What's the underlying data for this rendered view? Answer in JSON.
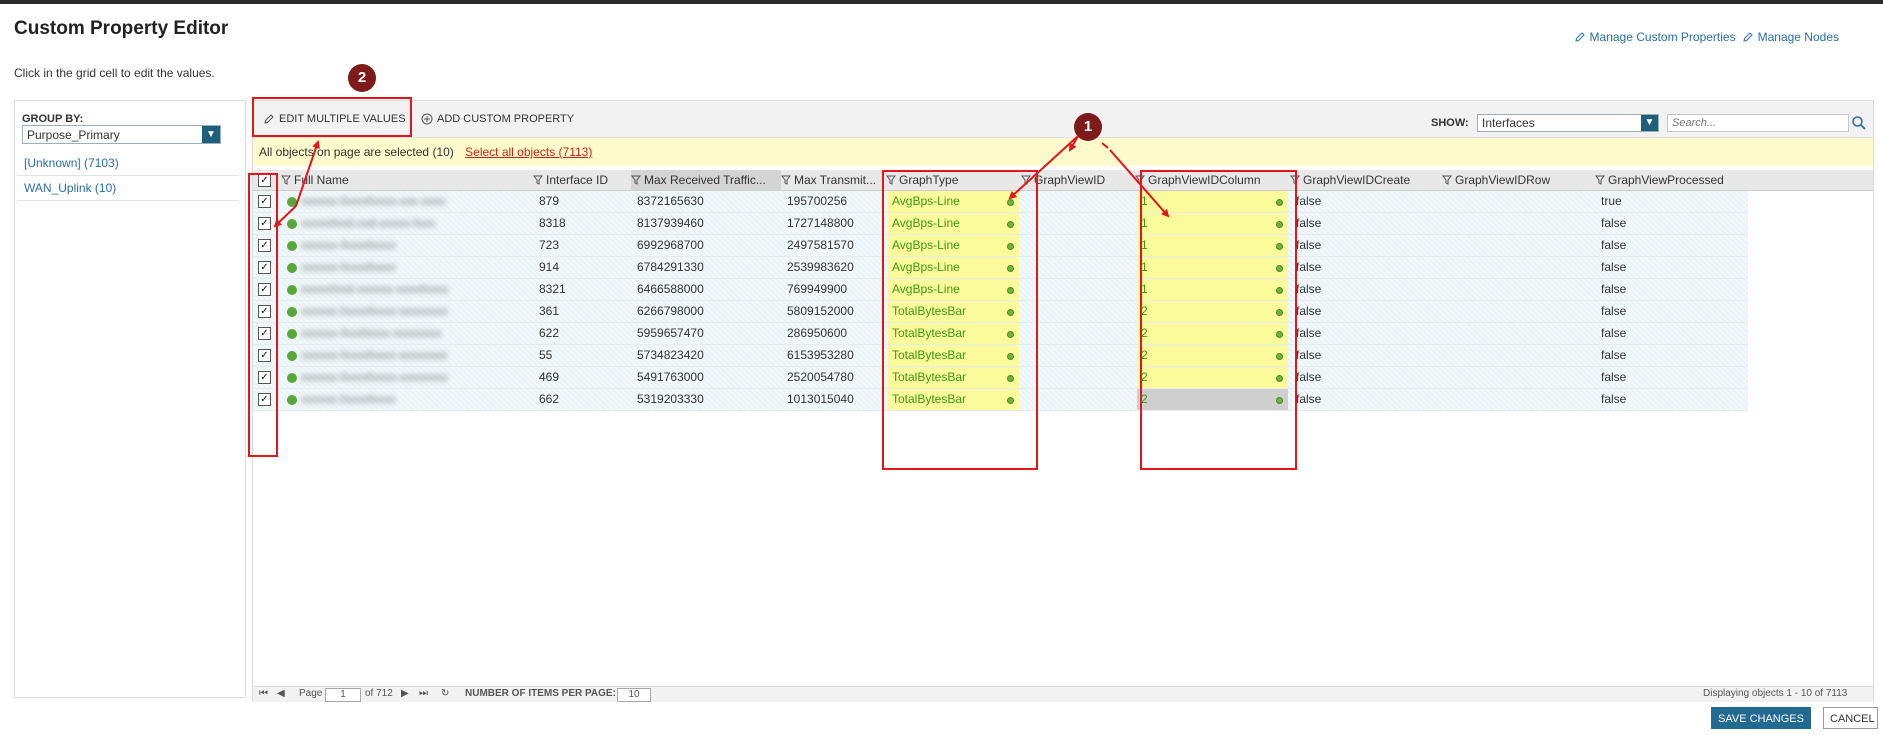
{
  "page": {
    "title": "Custom Property Editor",
    "subtitle": "Click in the grid cell to edit the values.",
    "links": [
      "Manage Custom Properties",
      "Manage Nodes"
    ]
  },
  "group_by": {
    "label": "GROUP BY:",
    "selected": "Purpose_Primary",
    "items": [
      "[Unknown] (7103)",
      "WAN_Uplink (10)"
    ]
  },
  "toolbar": {
    "edit_multiple": "EDIT MULTIPLE VALUES",
    "add_custom": "ADD CUSTOM PROPERTY",
    "show_label": "SHOW:",
    "show_value": "Interfaces",
    "search_placeholder": "Search..."
  },
  "selection": {
    "message": "All objects on page are selected (10)",
    "select_all": "Select all objects (7113)"
  },
  "columns": [
    "Full Name",
    "Interface ID",
    "Max Received Traffic...",
    "Max Transmit...",
    "GraphType",
    "GraphViewID",
    "GraphViewIDColumn",
    "GraphViewIDCreate",
    "GraphViewIDRow",
    "GraphViewProcessed"
  ],
  "rows": [
    {
      "name": "xxxxxx-fxxxxfxxxx-xxx-xxxx",
      "id": "879",
      "rx": "8372165630",
      "tx": "195700256",
      "gt": "AvgBps-Line",
      "gvc": "1",
      "create": "false",
      "processed": "true"
    },
    {
      "name": "xxxxxfxxd-xxd-xxxxx-fxxx",
      "id": "8318",
      "rx": "8137939460",
      "tx": "1727148800",
      "gt": "AvgBps-Line",
      "gvc": "1",
      "create": "false",
      "processed": "false"
    },
    {
      "name": "xxxxxx-fxxxxfxxxx",
      "id": "723",
      "rx": "6992968700",
      "tx": "2497581570",
      "gt": "AvgBps-Line",
      "gvc": "1",
      "create": "false",
      "processed": "false"
    },
    {
      "name": "xxxxxx-fxxxxfxxxx",
      "id": "914",
      "rx": "6784291330",
      "tx": "2539983620",
      "gt": "AvgBps-Line",
      "gvc": "1",
      "create": "false",
      "processed": "false"
    },
    {
      "name": "xxxxxfxxd-xxxxxx-xxxxfxxxx",
      "id": "8321",
      "rx": "6466588000",
      "tx": "769949900",
      "gt": "AvgBps-Line",
      "gvc": "1",
      "create": "false",
      "processed": "false"
    },
    {
      "name": "xxxxxx-fxxxxfxxxx-xxxxxxxx",
      "id": "361",
      "rx": "6266798000",
      "tx": "5809152000",
      "gt": "TotalBytesBar",
      "gvc": "2",
      "create": "false",
      "processed": "false"
    },
    {
      "name": "xxxxxx-fxxxfxxxx-xxxxxxxx",
      "id": "622",
      "rx": "5959657470",
      "tx": "286950600",
      "gt": "TotalBytesBar",
      "gvc": "2",
      "create": "false",
      "processed": "false"
    },
    {
      "name": "xxxxxx-fxxxxfxxxx-xxxxxxxx",
      "id": "55",
      "rx": "5734823420",
      "tx": "6153953280",
      "gt": "TotalBytesBar",
      "gvc": "2",
      "create": "false",
      "processed": "false"
    },
    {
      "name": "xxxxxx-fxxxxfxxxx-xxxxxxxx",
      "id": "469",
      "rx": "5491763000",
      "tx": "2520054780",
      "gt": "TotalBytesBar",
      "gvc": "2",
      "create": "false",
      "processed": "false"
    },
    {
      "name": "xxxxxx-fxxxxfxxxx",
      "id": "662",
      "rx": "5319203330",
      "tx": "1013015040",
      "gt": "TotalBytesBar",
      "gvc": "2",
      "create": "false",
      "processed": "false"
    }
  ],
  "footer": {
    "page_label": "Page",
    "page_value": "1",
    "of_pages": "of 712",
    "items_label": "NUMBER OF ITEMS PER PAGE:",
    "items_value": "10",
    "displaying": "Displaying objects 1 - 10 of 7113"
  },
  "buttons": {
    "save": "SAVE CHANGES",
    "cancel": "CANCEL"
  },
  "annotations": {
    "marker_1": "1",
    "marker_2": "2",
    "color": "#e3161b"
  },
  "colors": {
    "accent": "#216a92",
    "link": "#2a6ea6",
    "highlight": "#fbfb9c",
    "green_text": "#3c9a14"
  }
}
